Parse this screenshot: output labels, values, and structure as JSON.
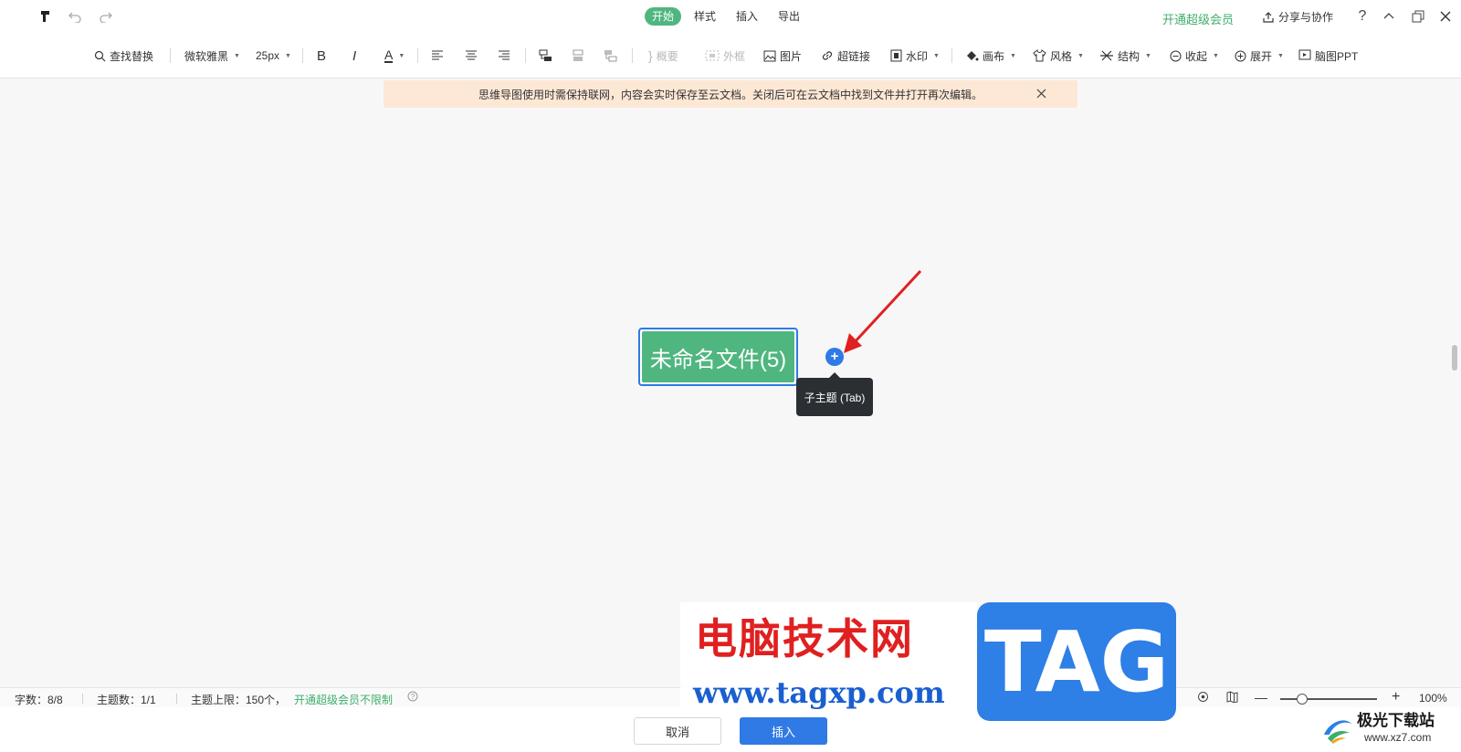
{
  "topbar": {
    "tabs": [
      {
        "label": "开始",
        "active": true
      },
      {
        "label": "样式",
        "active": false
      },
      {
        "label": "插入",
        "active": false
      },
      {
        "label": "导出",
        "active": false
      }
    ],
    "vip_label": "开通超级会员",
    "share_label": "分享与协作",
    "help_icon": "question-icon"
  },
  "toolbar": {
    "find_replace": "查找替换",
    "font_family": "微软雅黑",
    "font_size": "25px",
    "bold": "B",
    "italic": "I",
    "font_color": "A",
    "summary": "概要",
    "frame": "外框",
    "image": "图片",
    "hyperlink": "超链接",
    "watermark": "水印",
    "canvas": "画布",
    "style": "风格",
    "structure": "结构",
    "collapse": "收起",
    "expand": "展开",
    "mindmap_ppt": "脑图PPT"
  },
  "notice": {
    "text": "思维导图使用时需保持联网，内容会实时保存至云文档。关闭后可在云文档中找到文件并打开再次编辑。"
  },
  "canvas": {
    "root_node": "未命名文件(5)",
    "add_child_tooltip": "子主题 (Tab)"
  },
  "status": {
    "word_count": "字数：8/8",
    "topic_count": "主题数：1/1",
    "topic_limit": "主题上限：150个，",
    "unlimited_link": "开通超级会员不限制",
    "zoom": "100%"
  },
  "bottom": {
    "cancel": "取消",
    "insert": "插入"
  },
  "watermark": {
    "site_name": "电脑技术网",
    "site_url": "www.tagxp.com",
    "badge": "TAG",
    "corner_name": "极光下载站",
    "corner_url": "www.xz7.com"
  },
  "colors": {
    "accent_green": "#4fb680",
    "accent_blue": "#2f7ae5",
    "notice_bg": "#fde8d6",
    "arrow_red": "#e02020"
  }
}
